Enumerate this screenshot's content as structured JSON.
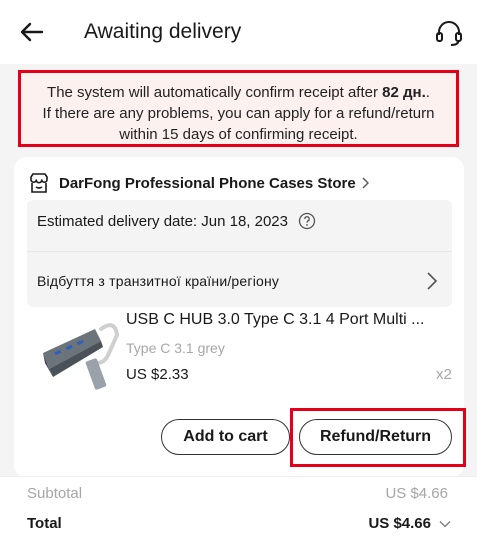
{
  "header": {
    "title": "Awaiting delivery",
    "back_icon": "arrow-left-icon",
    "support_icon": "headset-icon"
  },
  "notice": {
    "line1_prefix": "The system will automatically confirm receipt after ",
    "line1_bold": "82 дн.",
    "line1_suffix": ".",
    "line2": "If there are any problems, you can apply for a refund/return",
    "line3": "within 15 days of confirming receipt."
  },
  "order": {
    "store_name": "DarFong Professional Phone Cases Store",
    "estimated_delivery": "Estimated delivery date: Jun 18, 2023",
    "tracking_status": "Відбуття з транзитної країни/регіону",
    "product": {
      "title": "USB C HUB 3.0 Type C 3.1 4 Port Multi ...",
      "variant": "Type C 3.1 grey",
      "price": "US $2.33",
      "quantity": "x2"
    },
    "actions": {
      "add_to_cart": "Add to cart",
      "refund_return": "Refund/Return"
    }
  },
  "summary": {
    "subtotal_label": "Subtotal",
    "subtotal_value": "US $4.66",
    "total_label": "Total",
    "total_value": "US $4.66"
  },
  "colors": {
    "highlight": "#e5001a",
    "muted_text": "#a6a6a6",
    "page_bg": "#f4f4f4"
  }
}
